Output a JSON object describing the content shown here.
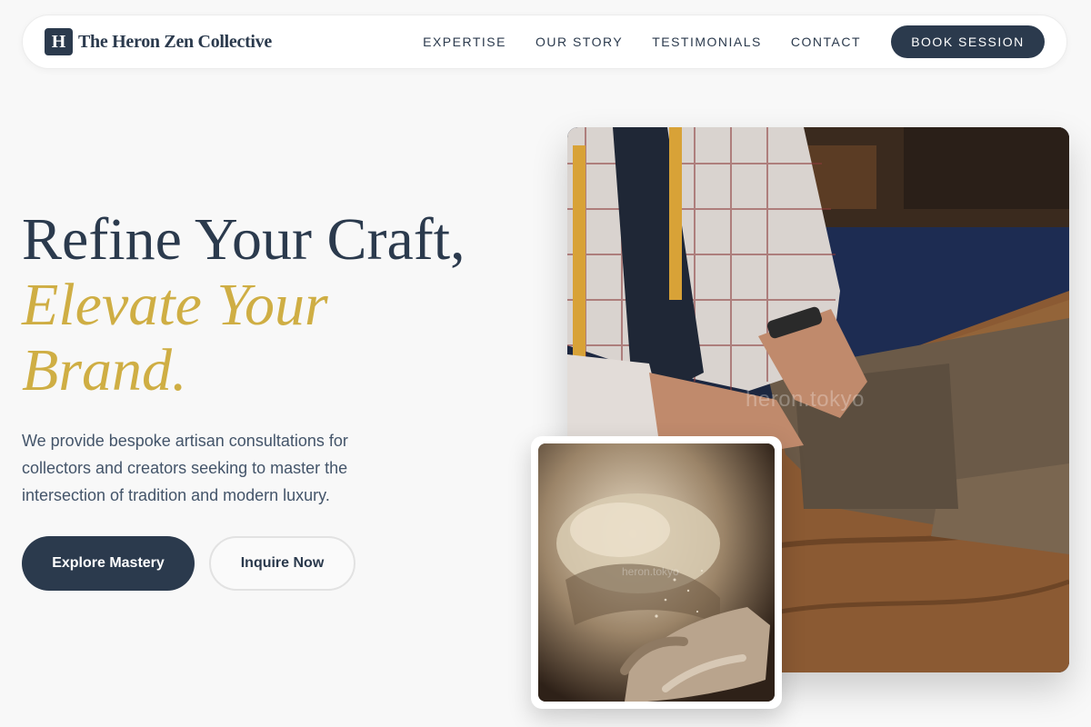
{
  "brand": {
    "logo_letter": "H",
    "name": "The Heron Zen Collective"
  },
  "nav": {
    "links": [
      "EXPERTISE",
      "OUR STORY",
      "TESTIMONIALS",
      "CONTACT"
    ],
    "cta": "BOOK SESSION"
  },
  "hero": {
    "headline_line1": "Refine Your Craft,",
    "headline_accent": "Elevate Your Brand.",
    "lead": "We provide bespoke artisan consultations for collectors and creators seeking to master the intersection of tradition and modern luxury.",
    "primary_button": "Explore Mastery",
    "secondary_button": "Inquire Now"
  },
  "images": {
    "main_watermark": "heron.tokyo",
    "inset_watermark": "heron.tokyo"
  },
  "colors": {
    "navy": "#2b3a4d",
    "gold": "#cfae44",
    "background": "#f8f8f8"
  }
}
